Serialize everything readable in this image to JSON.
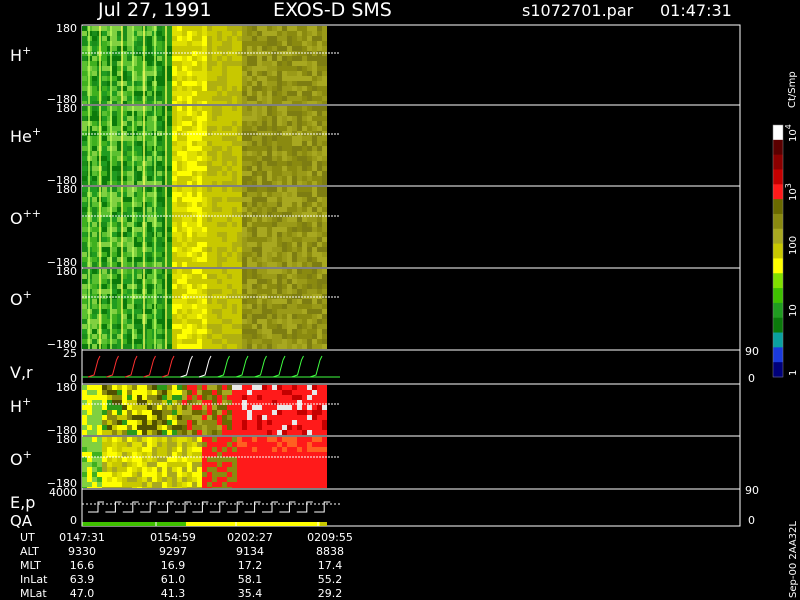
{
  "header": {
    "date": "Jul 27, 1991",
    "instrument": "EXOS-D SMS",
    "file": "s1072701.par",
    "time": "01:47:31"
  },
  "panels": [
    {
      "id": "H+",
      "label": "H",
      "sup": "+",
      "ytop": "180",
      "ybot": "−180",
      "kind": "spectrogram"
    },
    {
      "id": "He+",
      "label": "He",
      "sup": "+",
      "ytop": "180",
      "ybot": "−180",
      "kind": "spectrogram"
    },
    {
      "id": "O++",
      "label": "O",
      "sup": "++",
      "ytop": "180",
      "ybot": "−180",
      "kind": "spectrogram"
    },
    {
      "id": "O+",
      "label": "O",
      "sup": "+",
      "ytop": "180",
      "ybot": "−180",
      "kind": "spectrogram"
    },
    {
      "id": "Vr",
      "label": "V,r",
      "sup": "",
      "ytop": "25",
      "ybot": "0",
      "rtop": "90",
      "rbot": "0",
      "kind": "sweep"
    },
    {
      "id": "H+2",
      "label": "H",
      "sup": "+",
      "ytop": "180",
      "ybot": "−180",
      "kind": "spectrogram"
    },
    {
      "id": "O+2",
      "label": "O",
      "sup": "+",
      "ytop": "180",
      "ybot": "−180",
      "kind": "spectrogram"
    },
    {
      "id": "Ep",
      "label": "E,p",
      "label2": "QA",
      "sup": "",
      "ytop": "4000",
      "ybot": "0",
      "rtop": "90",
      "rbot": "0",
      "kind": "sweep"
    }
  ],
  "colorbar": {
    "units": "Ct/Smp",
    "ticks": [
      {
        "base": "10",
        "exp": "4"
      },
      {
        "base": "10",
        "exp": "3"
      },
      {
        "base": "100",
        "exp": ""
      },
      {
        "base": "10",
        "exp": ""
      },
      {
        "base": "1",
        "exp": ""
      }
    ],
    "colors": [
      "#ffffff",
      "#5a0000",
      "#8b0000",
      "#c40000",
      "#ff1a1a",
      "#6b6a00",
      "#8a8a10",
      "#a8a820",
      "#c8c800",
      "#ffff00",
      "#80e000",
      "#3fc000",
      "#209c20",
      "#0b7a0b",
      "#0aa0a0",
      "#1a3adc",
      "#00007a"
    ]
  },
  "side_note": "Sep-00 2AA32L",
  "ephemeris": {
    "rows": [
      {
        "name": "UT",
        "values": [
          "0147:31",
          "0154:59",
          "0202:27",
          "0209:55"
        ]
      },
      {
        "name": "ALT",
        "values": [
          "9330",
          "9297",
          "9134",
          "8838"
        ]
      },
      {
        "name": "MLT",
        "values": [
          "16.6",
          "16.9",
          "17.2",
          "17.4"
        ]
      },
      {
        "name": "InLat",
        "values": [
          "63.9",
          "61.0",
          "58.1",
          "55.2"
        ]
      },
      {
        "name": "MLat",
        "values": [
          "47.0",
          "41.3",
          "35.4",
          "29.2"
        ]
      }
    ]
  },
  "chart_data": {
    "type": "heatmap",
    "title": "Jul 27, 1991   EXOS-D SMS",
    "xlabel": "UT",
    "x": [
      "0147:31",
      "0154:59",
      "0202:27",
      "0209:55"
    ],
    "ylim": [
      -180,
      180
    ],
    "z_scale": "log",
    "z_units": "Ct/Smp",
    "z_range": [
      1,
      10000
    ],
    "grid": false,
    "legend": "colorbar right"
  }
}
